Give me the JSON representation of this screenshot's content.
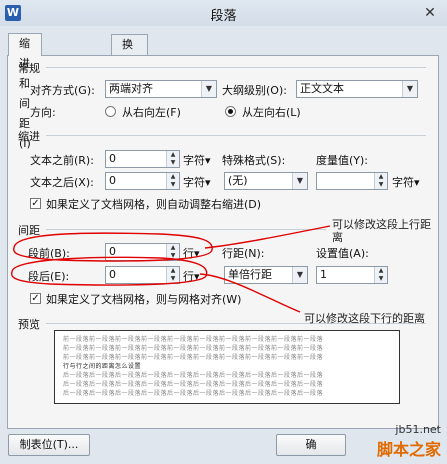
{
  "window": {
    "title": "段落",
    "app_icon": "W",
    "close": "✕"
  },
  "tabs": [
    {
      "label": "缩进和间距(I)"
    },
    {
      "label": "换行和分页(P)"
    }
  ],
  "general": {
    "section": "常规",
    "align_label": "对齐方式(G):",
    "align_value": "两端对齐",
    "outline_label": "大纲级别(O):",
    "outline_value": "正文文本",
    "direction_label": "方向:",
    "rtl_label": "从右向左(F)",
    "ltr_label": "从左向右(L)",
    "direction_selected": "ltr"
  },
  "indent": {
    "section": "缩进",
    "before_label": "文本之前(R):",
    "before_value": "0",
    "before_unit": "字符▾",
    "after_label": "文本之后(X):",
    "after_value": "0",
    "after_unit": "字符▾",
    "special_label": "特殊格式(S):",
    "special_value": "(无)",
    "measure_label": "度量值(Y):",
    "measure_value": "",
    "measure_unit": "字符▾",
    "auto_adjust_label": "如果定义了文档网格，则自动调整右缩进(D)",
    "auto_adjust_checked": true
  },
  "spacing": {
    "section": "间距",
    "before_label": "段前(B):",
    "before_value": "0",
    "before_unit": "行▾",
    "after_label": "段后(E):",
    "after_value": "0",
    "after_unit": "行▾",
    "line_label": "行距(N):",
    "line_value": "单倍行距",
    "setting_label": "设置值(A):",
    "setting_value": "1",
    "grid_label": "如果定义了文档网格，则与网格对齐(W)",
    "grid_checked": true
  },
  "preview": {
    "section": "预览",
    "lines": [
      "前一段落前一段落前一段落前一段落前一段落前一段落前一段落前一段落前一段落前一段落",
      "前一段落前一段落前一段落前一段落前一段落前一段落前一段落前一段落前一段落前一段落",
      "前一段落前一段落前一段落前一段落前一段落前一段落前一段落前一段落前一段落前一段落",
      "行与行之间的距离怎么设置",
      "后一段落后一段落后一段落后一段落后一段落后一段落后一段落后一段落后一段落后一段落",
      "后一段落后一段落后一段落后一段落后一段落后一段落后一段落后一段落后一段落后一段落",
      "后一段落后一段落后一段落后一段落后一段落后一段落后一段落后一段落后一段落后一段落"
    ]
  },
  "buttons": {
    "tabs": "制表位(T)...",
    "ok": "确"
  },
  "annotations": {
    "top_line1": "可以修改这段上行距",
    "top_line2": "离",
    "bottom": "可以修改这段下行的距离"
  },
  "watermark": {
    "site": "jb51.net",
    "brand": "脚本之家"
  },
  "colors": {
    "annotation_ink": "#e00000",
    "watermark": "#e06a00"
  }
}
